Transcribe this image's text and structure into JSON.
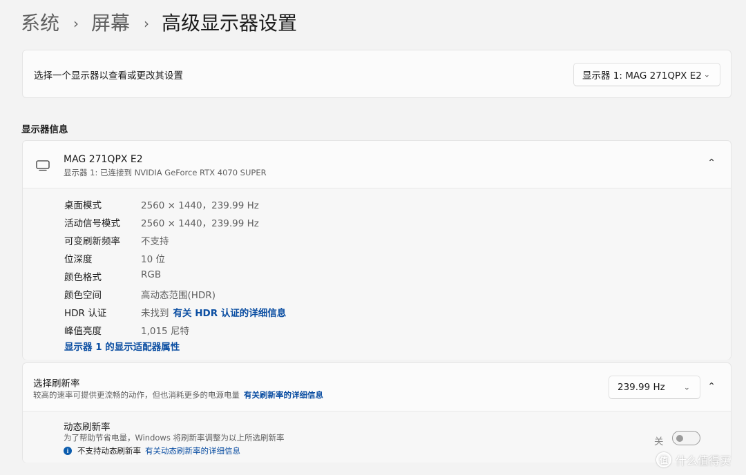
{
  "breadcrumb": {
    "items": [
      "系统",
      "屏幕"
    ],
    "current": "高级显示器设置",
    "separator": "›"
  },
  "selector": {
    "label": "选择一个显示器以查看或更改其设置",
    "value": "显示器 1: MAG 271QPX E2"
  },
  "section_title": "显示器信息",
  "monitor": {
    "name": "MAG 271QPX E2",
    "connection": "显示器 1: 已连接到 NVIDIA GeForce RTX 4070 SUPER",
    "icon": "monitor-icon"
  },
  "info_rows": [
    {
      "key": "桌面模式",
      "value": "2560 × 1440，239.99 Hz"
    },
    {
      "key": "活动信号模式",
      "value": "2560 × 1440，239.99 Hz"
    },
    {
      "key": "可变刷新频率",
      "value": "不支持"
    },
    {
      "key": "位深度",
      "value": "10 位"
    },
    {
      "key": "颜色格式",
      "value": "RGB"
    },
    {
      "key": "颜色空间",
      "value": "高动态范围(HDR)"
    },
    {
      "key": "HDR 认证",
      "value": "未找到",
      "link": "有关 HDR 认证的详细信息"
    },
    {
      "key": "峰值亮度",
      "value": "1,015 尼特"
    }
  ],
  "adapter_link": "显示器 1 的显示适配器属性",
  "refresh": {
    "title": "选择刷新率",
    "description": "较高的速率可提供更流畅的动作，但也消耗更多的电源电量",
    "link": "有关刷新率的详细信息",
    "value": "239.99 Hz"
  },
  "dynamic_refresh": {
    "title": "动态刷新率",
    "description": "为了帮助节省电量，Windows 将刷新率调整为以上所选刷新率",
    "note": "不支持动态刷新率",
    "note_link": "有关动态刷新率的详细信息",
    "toggle_label": "关",
    "toggle_on": false
  },
  "watermark": {
    "logo": "值",
    "text": "什么值得买"
  },
  "colors": {
    "link": "#0b4ea2",
    "background": "#f3f3f3",
    "card": "#fbfbfb",
    "info_icon": "#0b5cad"
  }
}
